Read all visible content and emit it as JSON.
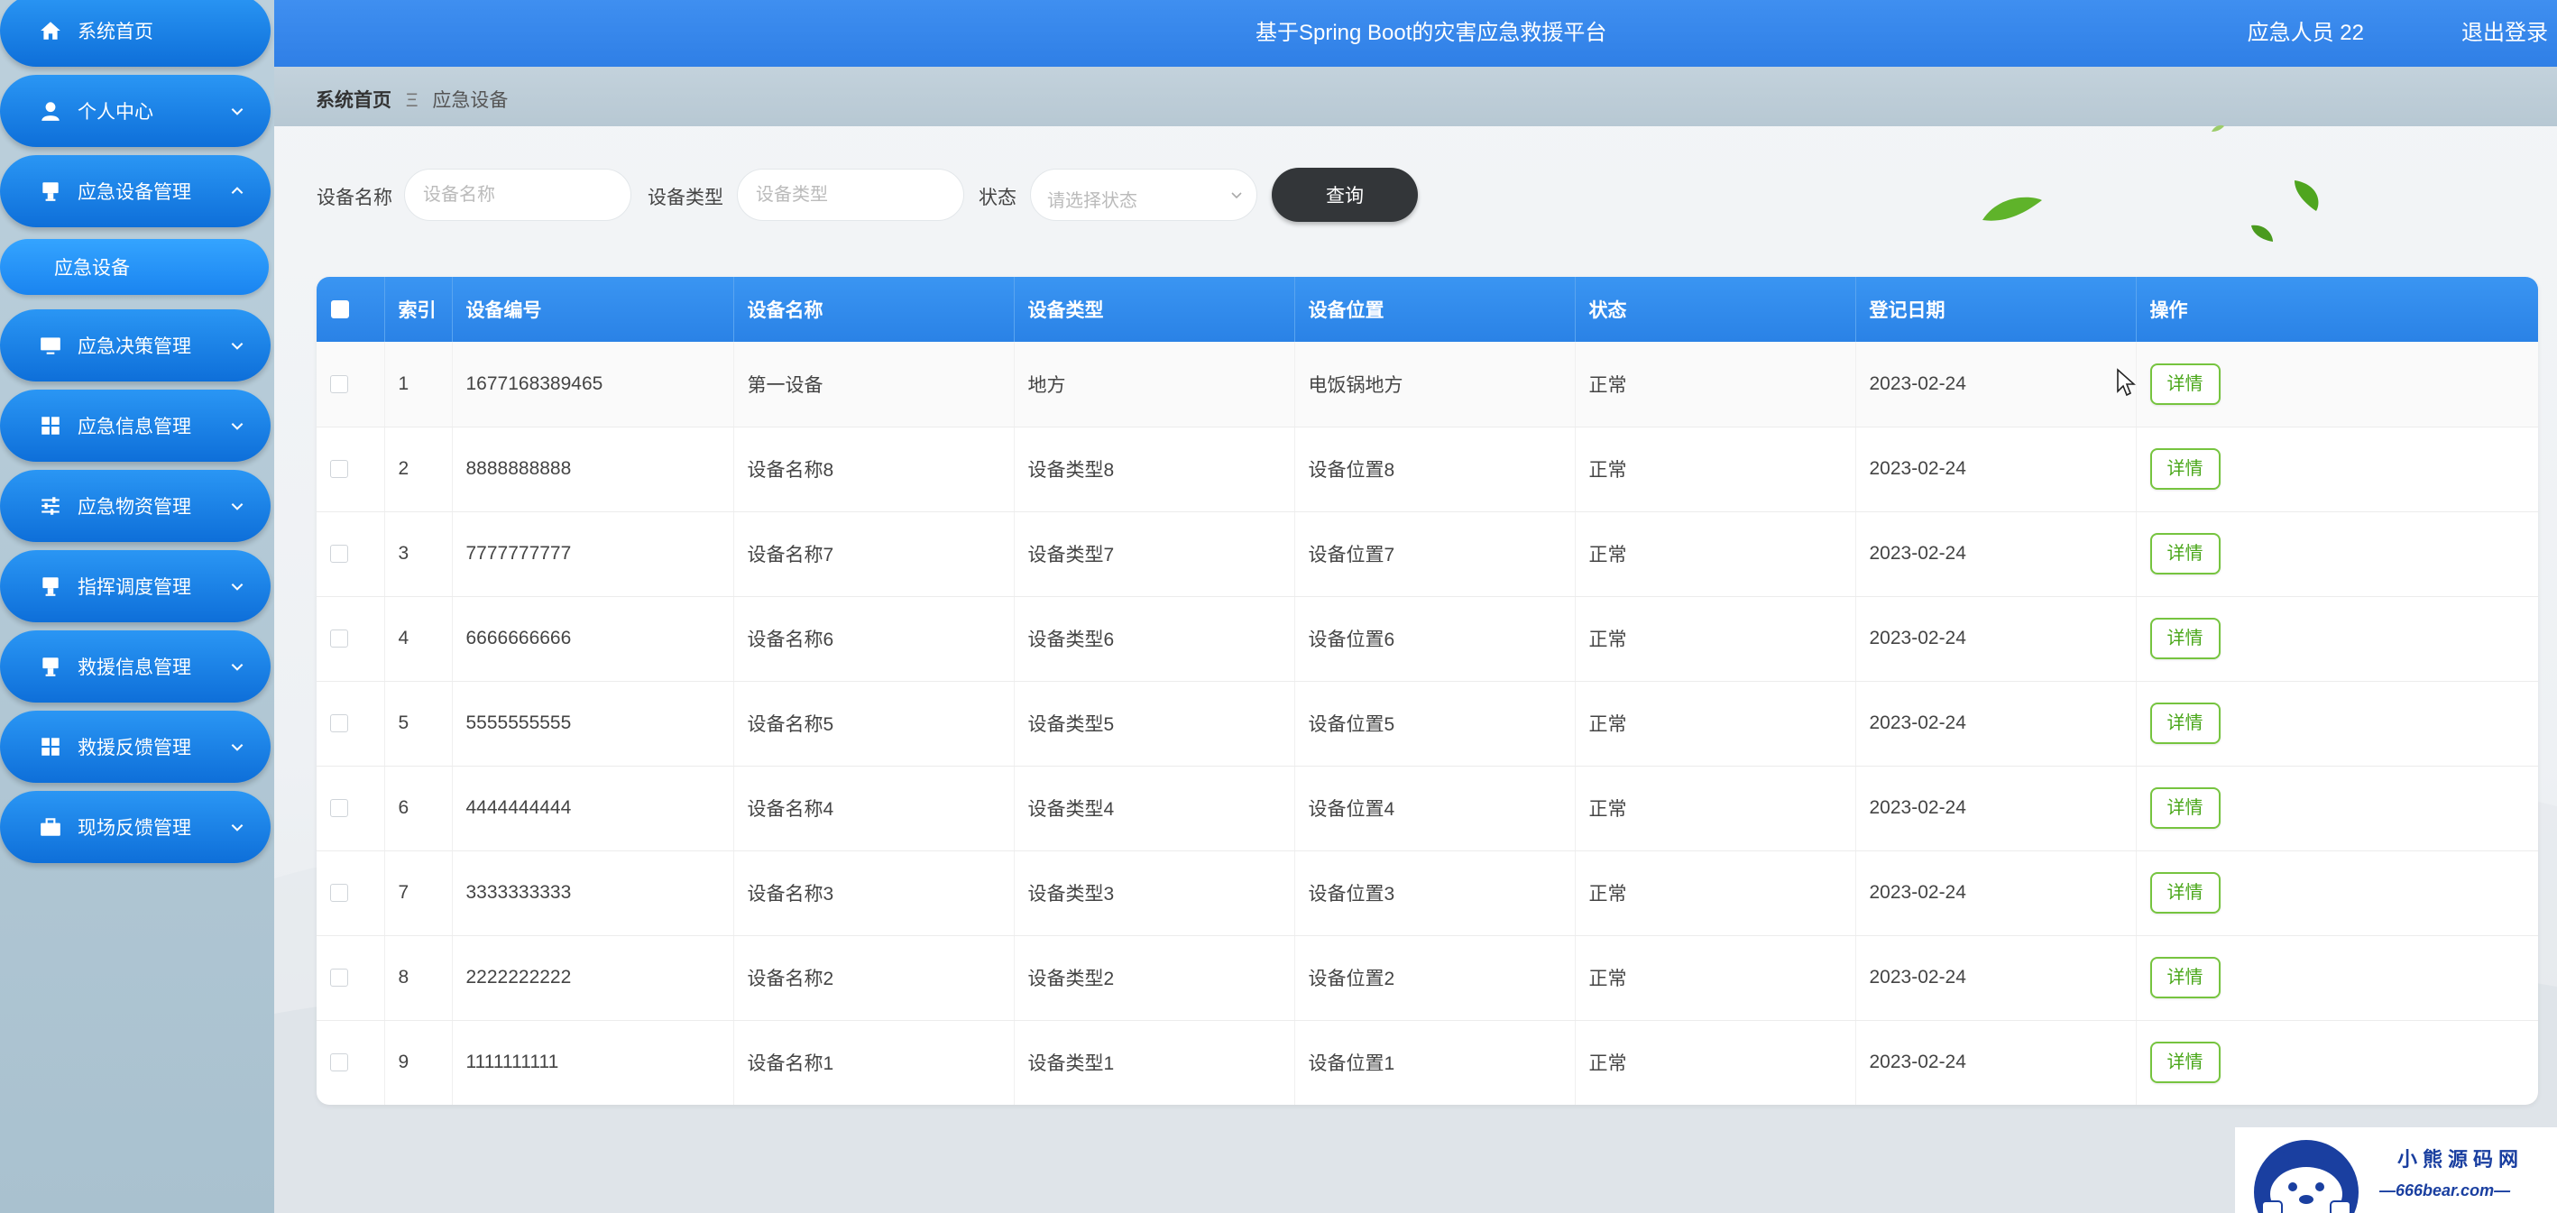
{
  "header": {
    "title": "基于Spring Boot的灾害应急救援平台",
    "user": "应急人员 22",
    "logout": "退出登录"
  },
  "sidebar": {
    "items": [
      {
        "label": "系统首页",
        "icon": "home-icon"
      },
      {
        "label": "个人中心",
        "icon": "user-icon"
      },
      {
        "label": "应急设备管理",
        "icon": "device-icon"
      },
      {
        "label": "应急决策管理",
        "icon": "monitor-icon"
      },
      {
        "label": "应急信息管理",
        "icon": "grid-icon"
      },
      {
        "label": "应急物资管理",
        "icon": "sliders-icon"
      },
      {
        "label": "指挥调度管理",
        "icon": "dispatch-icon"
      },
      {
        "label": "救援信息管理",
        "icon": "rescue-icon"
      },
      {
        "label": "救援反馈管理",
        "icon": "grid-icon"
      },
      {
        "label": "现场反馈管理",
        "icon": "briefcase-icon"
      }
    ],
    "submenu_active": "应急设备"
  },
  "breadcrumb": {
    "home": "系统首页",
    "separator": "Ξ",
    "current": "应急设备"
  },
  "search": {
    "name_label": "设备名称",
    "name_placeholder": "设备名称",
    "type_label": "设备类型",
    "type_placeholder": "设备类型",
    "status_label": "状态",
    "status_placeholder": "请选择状态",
    "query_label": "查询"
  },
  "table": {
    "headers": [
      "索引",
      "设备编号",
      "设备名称",
      "设备类型",
      "设备位置",
      "状态",
      "登记日期",
      "操作"
    ],
    "detail_label": "详情",
    "rows": [
      {
        "index": "1",
        "code": "1677168389465",
        "name": "第一设备",
        "type": "地方",
        "location": "电饭锅地方",
        "status": "正常",
        "date": "2023-02-24"
      },
      {
        "index": "2",
        "code": "8888888888",
        "name": "设备名称8",
        "type": "设备类型8",
        "location": "设备位置8",
        "status": "正常",
        "date": "2023-02-24"
      },
      {
        "index": "3",
        "code": "7777777777",
        "name": "设备名称7",
        "type": "设备类型7",
        "location": "设备位置7",
        "status": "正常",
        "date": "2023-02-24"
      },
      {
        "index": "4",
        "code": "6666666666",
        "name": "设备名称6",
        "type": "设备类型6",
        "location": "设备位置6",
        "status": "正常",
        "date": "2023-02-24"
      },
      {
        "index": "5",
        "code": "5555555555",
        "name": "设备名称5",
        "type": "设备类型5",
        "location": "设备位置5",
        "status": "正常",
        "date": "2023-02-24"
      },
      {
        "index": "6",
        "code": "4444444444",
        "name": "设备名称4",
        "type": "设备类型4",
        "location": "设备位置4",
        "status": "正常",
        "date": "2023-02-24"
      },
      {
        "index": "7",
        "code": "3333333333",
        "name": "设备名称3",
        "type": "设备类型3",
        "location": "设备位置3",
        "status": "正常",
        "date": "2023-02-24"
      },
      {
        "index": "8",
        "code": "2222222222",
        "name": "设备名称2",
        "type": "设备类型2",
        "location": "设备位置2",
        "status": "正常",
        "date": "2023-02-24"
      },
      {
        "index": "9",
        "code": "1111111111",
        "name": "设备名称1",
        "type": "设备类型1",
        "location": "设备位置1",
        "status": "正常",
        "date": "2023-02-24"
      }
    ]
  },
  "watermark": {
    "brand": "小熊源码网",
    "site": "—666bear.com—"
  },
  "colors": {
    "header_bg": "#3f8ff0",
    "menu_bg": "#1a84f0",
    "table_header": "#2a82e6",
    "detail_green": "#76c43f",
    "query_btn": "#333639"
  }
}
